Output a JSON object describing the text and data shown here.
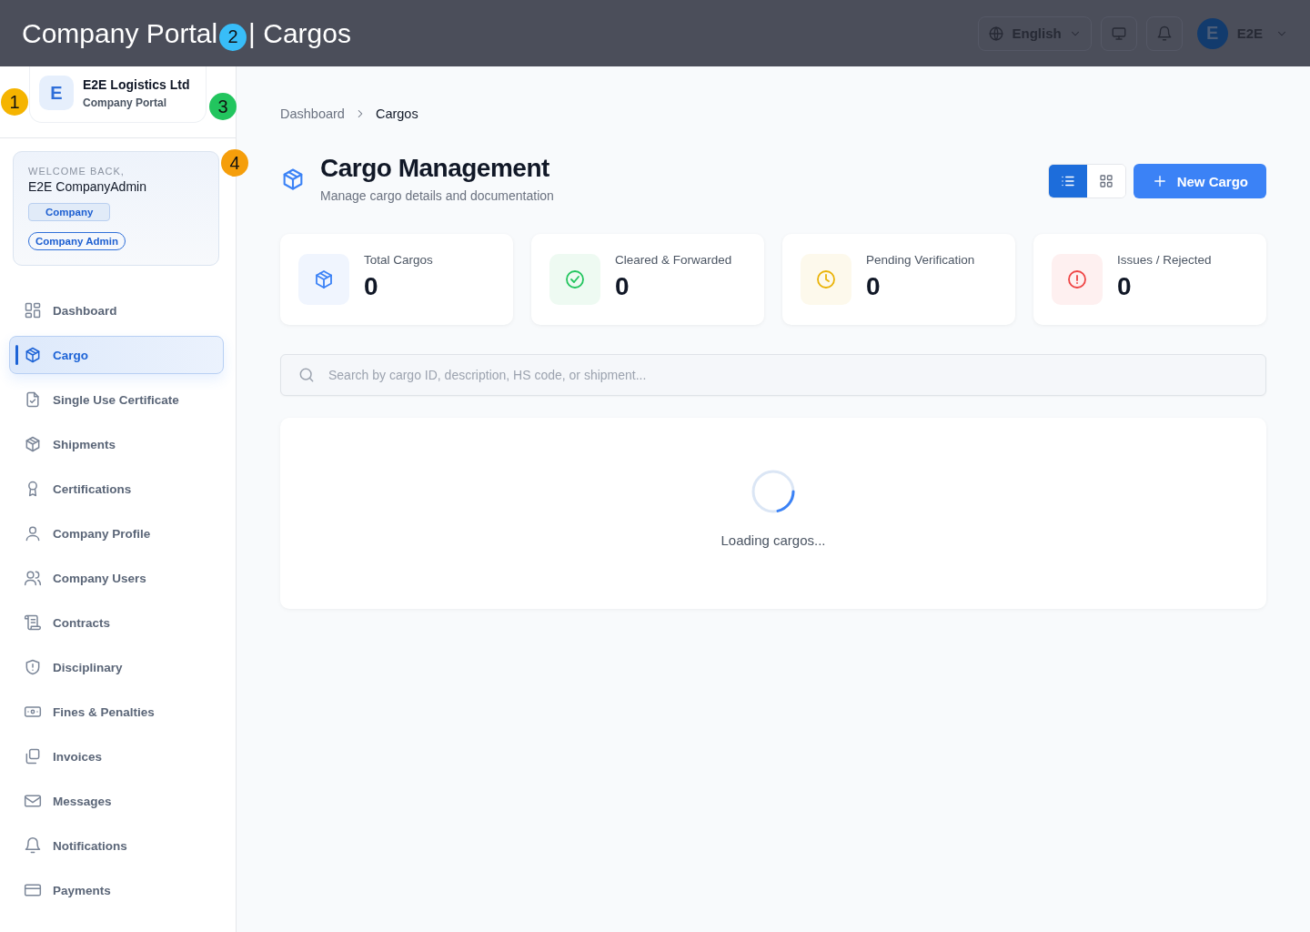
{
  "overlay_title": [
    "Company Portal",
    "| Cargos"
  ],
  "markers": [
    {
      "label": "1",
      "color": "#f5b400"
    },
    {
      "label": "2",
      "color": "#38bdf8"
    },
    {
      "label": "3",
      "color": "#22c55e"
    },
    {
      "label": "4",
      "color": "#f59e0b"
    }
  ],
  "header": {
    "language": "English",
    "avatar": "E",
    "user": "E2E"
  },
  "sidebar": {
    "org": {
      "avatar": "E",
      "name": "E2E Logistics Ltd",
      "subtitle": "Company Portal"
    },
    "welcome": {
      "greeting": "WELCOME BACK,",
      "name": "E2E CompanyAdmin",
      "badges": [
        {
          "label": "Company",
          "kind": "square"
        },
        {
          "label": "Company Admin",
          "kind": "pill"
        }
      ]
    },
    "items": [
      {
        "label": "Dashboard",
        "selected": false
      },
      {
        "label": "Cargo",
        "selected": true
      },
      {
        "label": "Single Use Certificate",
        "selected": false
      },
      {
        "label": "Shipments",
        "selected": false
      },
      {
        "label": "Certifications",
        "selected": false
      },
      {
        "label": "Company Profile",
        "selected": false
      },
      {
        "label": "Company Users",
        "selected": false
      },
      {
        "label": "Contracts",
        "selected": false
      },
      {
        "label": "Disciplinary",
        "selected": false
      },
      {
        "label": "Fines & Penalties",
        "selected": false
      },
      {
        "label": "Invoices",
        "selected": false
      },
      {
        "label": "Messages",
        "selected": false
      },
      {
        "label": "Notifications",
        "selected": false
      },
      {
        "label": "Payments",
        "selected": false
      }
    ]
  },
  "breadcrumb": [
    "Dashboard",
    "Cargos"
  ],
  "page": {
    "title": "Cargo Management",
    "subtitle": "Manage cargo details and documentation",
    "views": [
      {
        "kind": "list",
        "selected": true
      },
      {
        "kind": "grid",
        "selected": false
      }
    ],
    "new_button": "New Cargo"
  },
  "stats": [
    {
      "label": "Total Cargos",
      "value": "0",
      "color": "#3b82f6",
      "kind": "box"
    },
    {
      "label": "Cleared & Forwarded",
      "value": "0",
      "color": "#22c55e",
      "kind": "check"
    },
    {
      "label": "Pending Verification",
      "value": "0",
      "color": "#eab308",
      "kind": "clock"
    },
    {
      "label": "Issues / Rejected",
      "value": "0",
      "color": "#ef4444",
      "kind": "alert"
    }
  ],
  "search": {
    "placeholder": "Search by cargo ID, description, HS code, or shipment..."
  },
  "loading": {
    "text": "Loading cargos..."
  }
}
